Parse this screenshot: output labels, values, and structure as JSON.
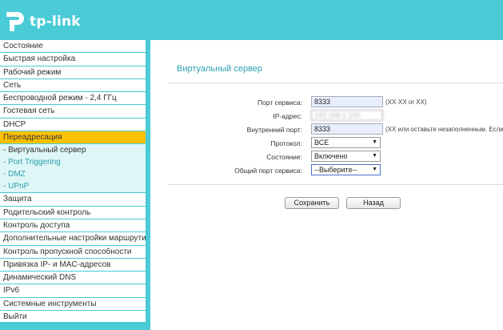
{
  "header": {
    "brand": "tp-link",
    "logo_icon": "tp-link-logo-icon"
  },
  "sidebar": {
    "items_top": [
      {
        "label": "Состояние"
      },
      {
        "label": "Быстрая настройка"
      },
      {
        "label": "Рабочий режим"
      },
      {
        "label": "Сеть"
      },
      {
        "label": "Беспроводной режим - 2,4 ГГц"
      },
      {
        "label": "Гостевая сеть"
      },
      {
        "label": "DHCP"
      },
      {
        "label": "Переадресация",
        "active": true
      }
    ],
    "sub_items": [
      {
        "label": "- Виртуальный сервер",
        "current": true
      },
      {
        "label": "- Port Triggering"
      },
      {
        "label": "- DMZ"
      },
      {
        "label": "- UPnP"
      }
    ],
    "items_bottom": [
      {
        "label": "Защита"
      },
      {
        "label": "Родительский контроль"
      },
      {
        "label": "Контроль доступа"
      },
      {
        "label": "Дополнительные настройки маршрутизации"
      },
      {
        "label": "Контроль пропускной способности"
      },
      {
        "label": "Привязка IP- и MAC-адресов"
      },
      {
        "label": "Динамический DNS"
      },
      {
        "label": "IPv6"
      },
      {
        "label": "Системные инструменты"
      },
      {
        "label": "Выйти"
      }
    ]
  },
  "main": {
    "title": "Виртуальный сервер",
    "form": {
      "service_port": {
        "label": "Порт сервиса:",
        "value": "8333",
        "hint": "(XX-XX or XX)"
      },
      "ip_address": {
        "label": "IP-адрес:",
        "value": "192.168.1.100"
      },
      "internal_port": {
        "label": "Внутренний порт:",
        "value": "8333",
        "hint": "(XX или оставьте незаполненным. Если п"
      },
      "protocol": {
        "label": "Протокол:",
        "value": "ВСЕ"
      },
      "status": {
        "label": "Состояние:",
        "value": "Включено"
      },
      "common_port": {
        "label": "Общий порт сервиса:",
        "value": "--Выберите--"
      }
    },
    "buttons": {
      "save": "Сохранить",
      "back": "Назад"
    }
  },
  "colors": {
    "accent": "#4acbd6",
    "active_menu": "#ffc200",
    "submenu_bg": "#dff6f7",
    "title": "#2d9fb0"
  }
}
